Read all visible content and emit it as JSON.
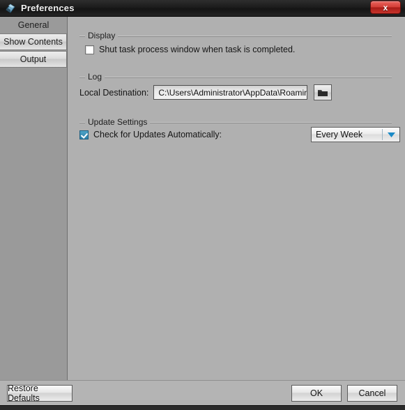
{
  "window": {
    "title": "Preferences",
    "app_icon": "preferences-app-icon",
    "close_label": "x"
  },
  "sidebar": {
    "items": [
      {
        "label": "General",
        "state": "selected"
      },
      {
        "label": "Show Contents",
        "state": "normal"
      },
      {
        "label": "Output",
        "state": "normal"
      }
    ]
  },
  "main": {
    "display_group": {
      "label": "Display",
      "shut_task_checkbox": {
        "label": "Shut task process window when task is completed.",
        "checked": false
      }
    },
    "log_group": {
      "label": "Log",
      "local_destination_label": "Local Destination:",
      "local_destination_value": "C:\\Users\\Administrator\\AppData\\Roaming\\log",
      "browse_icon": "folder-icon"
    },
    "update_group": {
      "label": "Update Settings",
      "check_updates_checkbox": {
        "label": "Check for Updates Automatically:",
        "checked": true
      },
      "frequency_value": "Every Week",
      "frequency_arrow_icon": "chevron-down-icon"
    }
  },
  "footer": {
    "restore_defaults_label": "Restore Defaults",
    "ok_label": "OK",
    "cancel_label": "Cancel"
  },
  "colors": {
    "titlebar": "#1c1c1c",
    "sidebar_bg": "#9a9a9a",
    "content_bg": "#b0b0b0",
    "accent_checkbox": "#2c7fa8",
    "accent_arrow": "#1b8ac6",
    "close_button": "#d43f37"
  }
}
